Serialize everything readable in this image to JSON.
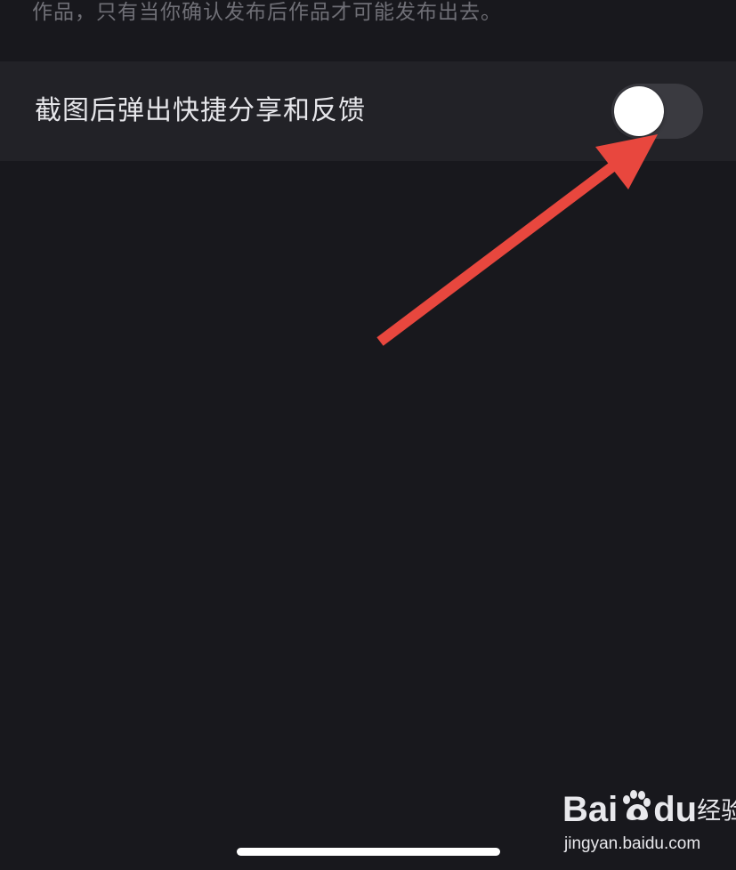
{
  "description_text": "作品，只有当你确认发布后作品才可能发布出去。",
  "setting": {
    "label": "截图后弹出快捷分享和反馈",
    "toggle_on": false
  },
  "watermark": {
    "logo_left": "Bai",
    "logo_right": "du",
    "logo_cn": "经验",
    "url": "jingyan.baidu.com"
  },
  "colors": {
    "background": "#18181d",
    "row_background": "#222227",
    "toggle_track_off": "#3a3a40",
    "annotation_arrow": "#e8473e"
  },
  "icons": {
    "toggle_knob": "toggle-knob",
    "annotation": "arrow-icon",
    "watermark_paw": "paw-icon"
  }
}
